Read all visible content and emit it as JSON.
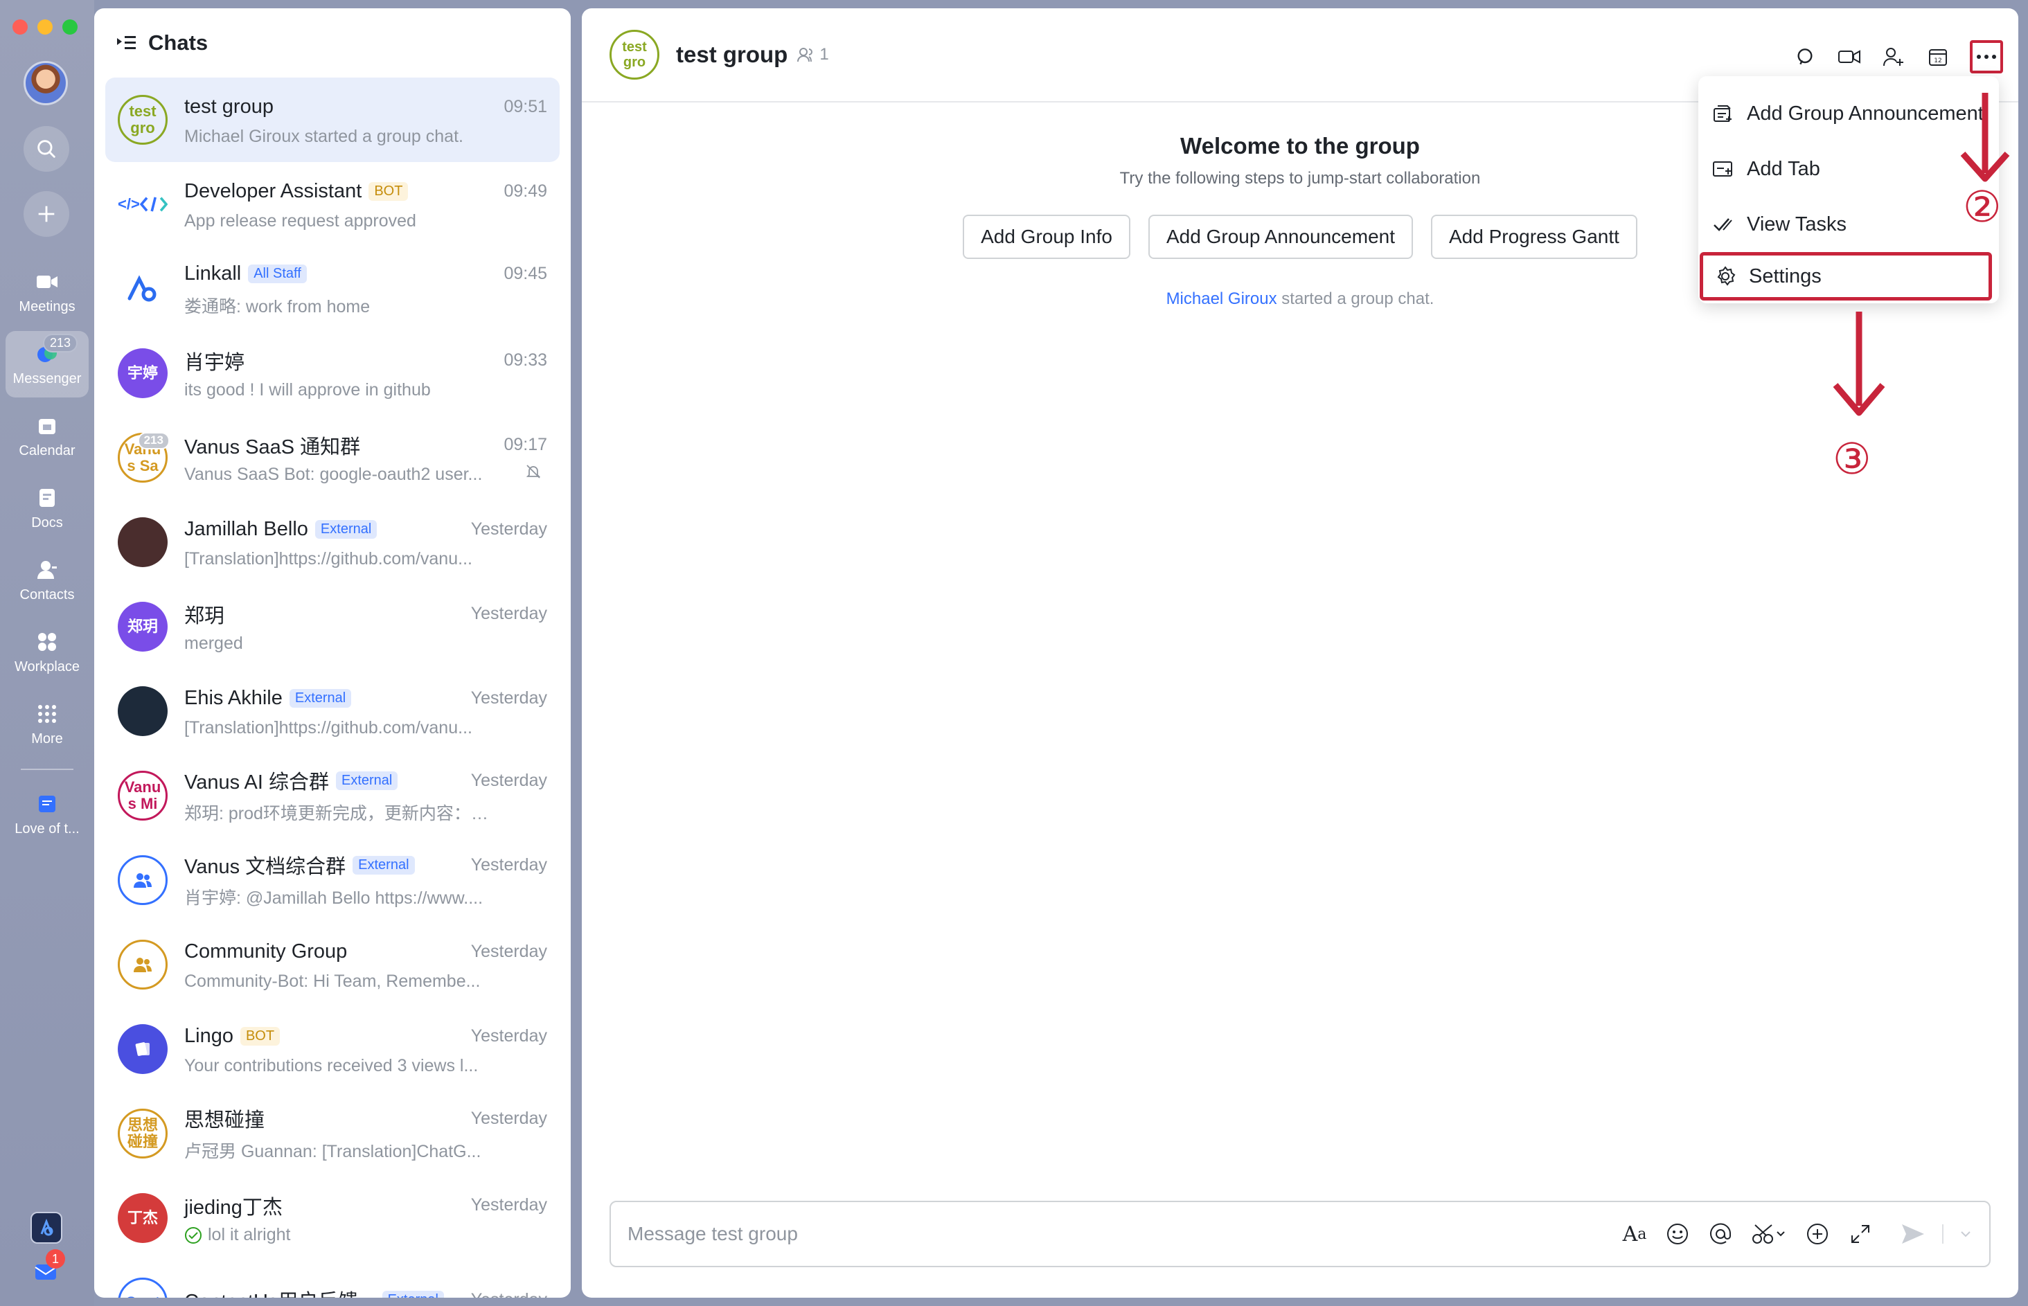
{
  "rail": {
    "nav": [
      {
        "label": "Meetings",
        "icon": "video-icon"
      },
      {
        "label": "Messenger",
        "icon": "chat-icon",
        "badge": "213"
      },
      {
        "label": "Calendar",
        "icon": "calendar-icon"
      },
      {
        "label": "Docs",
        "icon": "docs-icon"
      },
      {
        "label": "Contacts",
        "icon": "contacts-icon"
      },
      {
        "label": "Workplace",
        "icon": "workplace-icon"
      },
      {
        "label": "More",
        "icon": "more-grid-icon"
      },
      {
        "label": "Love of t...",
        "icon": "doc-shortcut-icon"
      }
    ],
    "mail_badge": "1"
  },
  "chat_list": {
    "title": "Chats",
    "items": [
      {
        "name": "test group",
        "time": "09:51",
        "preview": "Michael Giroux started a group chat.",
        "avatar_text": "test gro",
        "avatar_color": "#8aa823",
        "tag": ""
      },
      {
        "name": "Developer Assistant",
        "time": "09:49",
        "preview": "App release request approved",
        "avatar_text": "</>",
        "avatar_color": "#3370ff",
        "tag": "BOT"
      },
      {
        "name": "Linkall",
        "time": "09:45",
        "preview": "娄通略: work from home",
        "avatar_text": "",
        "avatar_color": "#2b6cf0",
        "tag": "All Staff"
      },
      {
        "name": "肖宇婷",
        "time": "09:33",
        "preview": "its good ! I will approve in github",
        "avatar_text": "宇婷",
        "avatar_color": "#7a4de8",
        "tag": ""
      },
      {
        "name": "Vanus SaaS 通知群",
        "time": "09:17",
        "preview": "Vanus SaaS Bot: google-oauth2 user...",
        "avatar_text": "Vanu s Sa",
        "avatar_color": "#d49a22",
        "tag": "",
        "badge": "213"
      },
      {
        "name": "Jamillah Bello",
        "time": "Yesterday",
        "preview": "[Translation]https://github.com/vanu...",
        "avatar_text": "",
        "avatar_color": "#4a2d2d",
        "tag": "External"
      },
      {
        "name": "郑玥",
        "time": "Yesterday",
        "preview": "merged",
        "avatar_text": "郑玥",
        "avatar_color": "#7a4de8",
        "tag": ""
      },
      {
        "name": "Ehis Akhile",
        "time": "Yesterday",
        "preview": "[Translation]https://github.com/vanu...",
        "avatar_text": "",
        "avatar_color": "#1d2a3a",
        "tag": "External"
      },
      {
        "name": "Vanus AI 综合群",
        "time": "Yesterday",
        "preview": "郑玥: prod环境更新完成，更新内容：  ...",
        "avatar_text": "Vanu s Mi",
        "avatar_color": "#c2185b",
        "tag": "External"
      },
      {
        "name": "Vanus 文档综合群",
        "time": "Yesterday",
        "preview": "肖宇婷: @Jamillah Bello https://www....",
        "avatar_text": "",
        "avatar_color": "#3370ff",
        "tag": "External"
      },
      {
        "name": "Community Group",
        "time": "Yesterday",
        "preview": "Community-Bot: Hi Team, Remembe...",
        "avatar_text": "",
        "avatar_color": "#d49a22",
        "tag": ""
      },
      {
        "name": "Lingo",
        "time": "Yesterday",
        "preview": "Your contributions received 3 views l...",
        "avatar_text": "",
        "avatar_color": "#4a4fe0",
        "tag": "BOT"
      },
      {
        "name": "思想碰撞",
        "time": "Yesterday",
        "preview": "卢冠男 Guannan: [Translation]ChatG...",
        "avatar_text": "思想 碰撞",
        "avatar_color": "#d49a22",
        "tag": ""
      },
      {
        "name": "jieding丁杰",
        "time": "Yesterday",
        "preview": "lol it alright",
        "avatar_text": "丁杰",
        "avatar_color": "#d43b3b",
        "tag": ""
      },
      {
        "name": "ContactUs用户反馈...",
        "time": "Yesterday",
        "preview": "",
        "avatar_text": "Cont",
        "avatar_color": "#3370ff",
        "tag": "External"
      }
    ]
  },
  "chat": {
    "title": "test group",
    "avatar_text": "test gro",
    "member_count": "1",
    "welcome_title": "Welcome to the group",
    "welcome_sub": "Try the following steps to jump-start collaboration",
    "buttons": [
      "Add Group Info",
      "Add Group Announcement",
      "Add Progress Gantt"
    ],
    "system_user": "Michael Giroux",
    "system_text": " started a group chat.",
    "composer_placeholder": "Message test group"
  },
  "menu": {
    "items": [
      {
        "label": "Add Group Announcement",
        "icon": "announcement-icon"
      },
      {
        "label": "Add Tab",
        "icon": "add-tab-icon"
      },
      {
        "label": "View Tasks",
        "icon": "tasks-check-icon"
      },
      {
        "label": "Settings",
        "icon": "gear-icon"
      }
    ]
  },
  "annotations": {
    "step2": "②",
    "step3": "③"
  },
  "colors": {
    "accent": "#3370ff",
    "highlight_red": "#c8243b",
    "selected_row": "#e8eefb"
  }
}
